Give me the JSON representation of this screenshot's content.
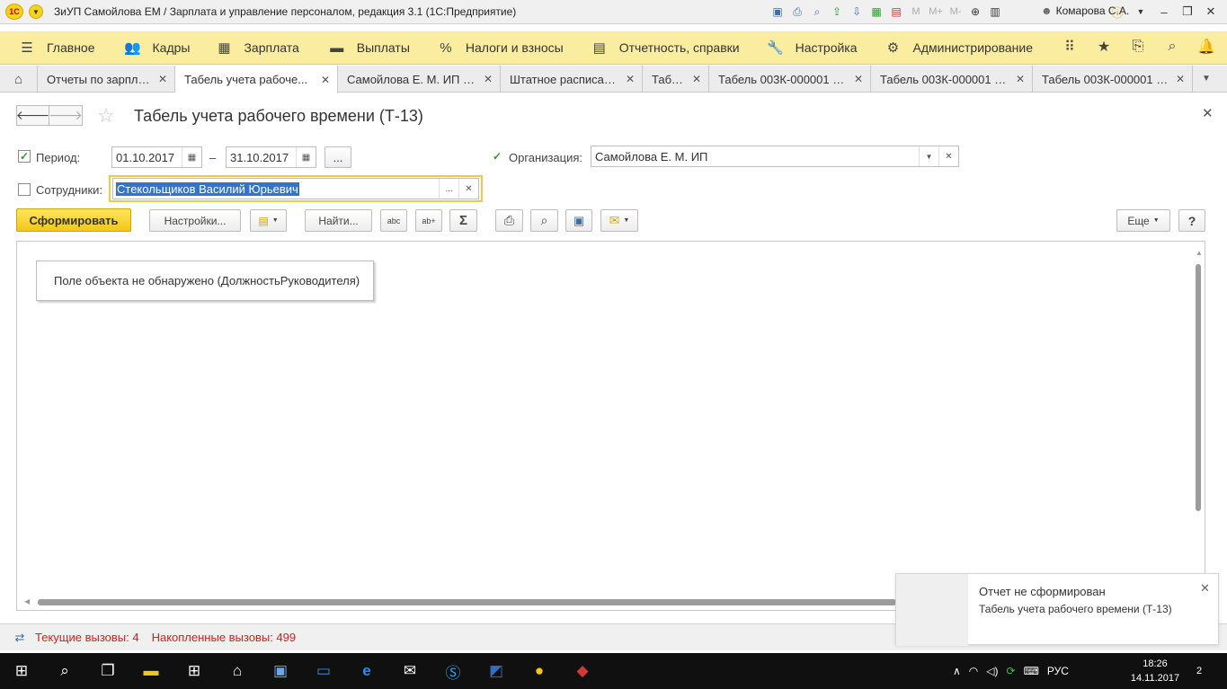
{
  "window": {
    "title": "ЗиУП Самойлова ЕМ / Зарплата и управление персоналом, редакция 3.1  (1С:Предприятие)",
    "user": "Комарова С.А.",
    "tools": [
      "save-icon",
      "print-icon",
      "preview-icon",
      "upload-icon",
      "download-icon",
      "calculator-icon",
      "calendar-icon",
      "m-icon",
      "m-plus-icon",
      "m-minus-icon",
      "zoom-icon",
      "panel-icon"
    ],
    "memory_labels": [
      "M",
      "M+",
      "M-"
    ]
  },
  "menu": {
    "items": [
      {
        "label": "Главное",
        "icon": "hamburger-icon"
      },
      {
        "label": "Кадры",
        "icon": "people-icon"
      },
      {
        "label": "Зарплата",
        "icon": "calculator-icon"
      },
      {
        "label": "Выплаты",
        "icon": "money-icon"
      },
      {
        "label": "Налоги и взносы",
        "icon": "percent-icon"
      },
      {
        "label": "Отчетность, справки",
        "icon": "report-icon"
      },
      {
        "label": "Настройка",
        "icon": "wrench-icon"
      },
      {
        "label": "Администрирование",
        "icon": "gear-icon"
      }
    ]
  },
  "tabs": [
    {
      "label": "Отчеты по зарплате",
      "active": false
    },
    {
      "label": "Табель учета рабоче...",
      "active": true
    },
    {
      "label": "Самойлова Е. М. ИП (...",
      "active": false
    },
    {
      "label": "Штатное расписание",
      "active": false
    },
    {
      "label": "Табели",
      "active": false
    },
    {
      "label": "Табель 003К-000001 о...",
      "active": false
    },
    {
      "label": "Табель 003К-000001 о...",
      "active": false
    },
    {
      "label": "Табель 003К-000001 о...",
      "active": false
    }
  ],
  "form": {
    "title": "Табель учета рабочего времени (Т-13)",
    "period_label": "Период:",
    "period_checked": true,
    "date_from": "01.10.2017",
    "date_to": "31.10.2017",
    "dash": "–",
    "ellipsis": "...",
    "org_label": "Организация:",
    "org_checked": true,
    "org_value": "Самойлова Е. М. ИП",
    "emp_label": "Сотрудники:",
    "emp_checked": false,
    "emp_value": "Стекольщиков Василий Юрьевич"
  },
  "toolbar": {
    "generate": "Сформировать",
    "settings": "Настройки...",
    "find": "Найти...",
    "more": "Еще",
    "help": "?"
  },
  "report": {
    "message": "Поле объекта не обнаружено (ДолжностьРуководителя)"
  },
  "status": {
    "current_calls": "Текущие вызовы: 4",
    "accumulated_calls": "Накопленные вызовы: 499"
  },
  "notification": {
    "title": "Отчет не сформирован",
    "text": "Табель учета рабочего времени (Т-13)"
  },
  "taskbar": {
    "language": "РУС",
    "time": "18:26",
    "date": "14.11.2017",
    "notify_count": "2"
  },
  "colors": {
    "menu_bg": "#fbeda0",
    "primary_btn": "#f3c71a",
    "status_text": "#d41f1f",
    "selection": "#3374c9"
  }
}
